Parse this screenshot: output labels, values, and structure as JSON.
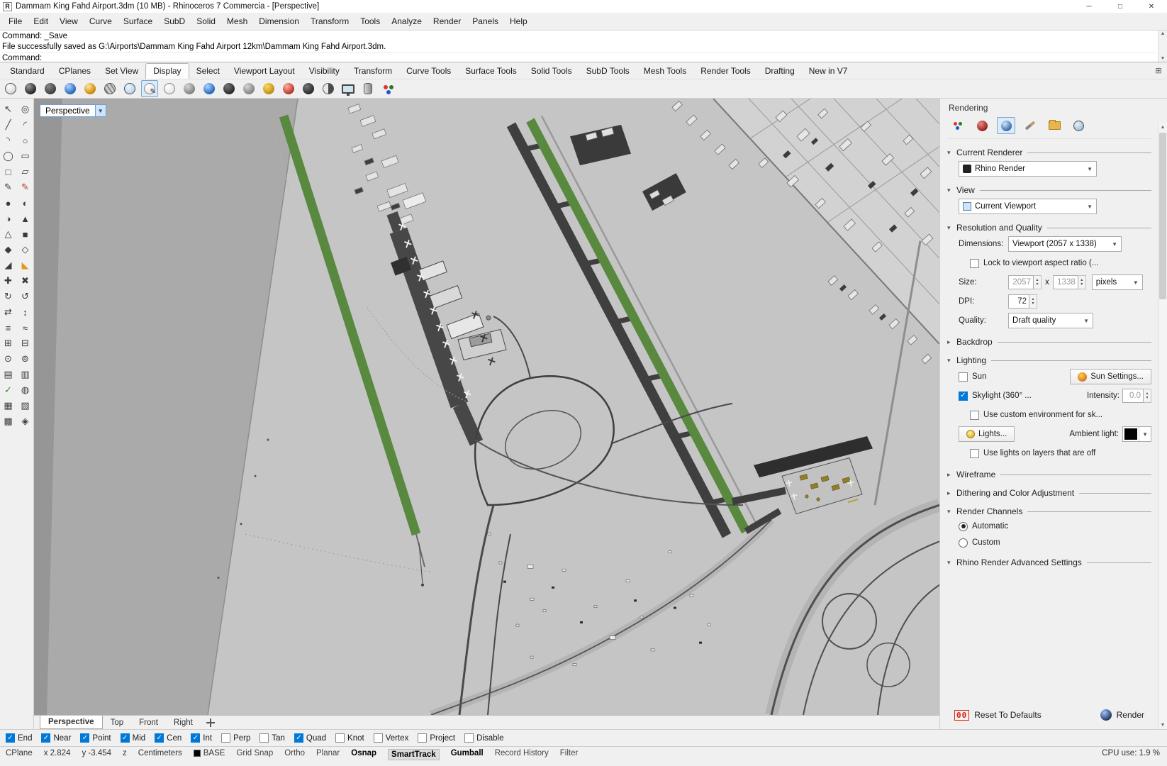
{
  "colors": {
    "runway_green": "#58893f",
    "taxiway_dark": "#3f3f3f",
    "ground_light": "#c5c5c5",
    "ground_mid": "#aaaaaa",
    "accent_blue": "#0078d7",
    "ambient_swatch": "#000000",
    "reset_icon_red": "#dd2211"
  },
  "titlebar": {
    "title": "Dammam King Fahd Airport.3dm (10 MB) - Rhinoceros 7 Commercia - [Perspective]"
  },
  "menubar": {
    "items": [
      "File",
      "Edit",
      "View",
      "Curve",
      "Surface",
      "SubD",
      "Solid",
      "Mesh",
      "Dimension",
      "Transform",
      "Tools",
      "Analyze",
      "Render",
      "Panels",
      "Help"
    ]
  },
  "command": {
    "history": [
      "Command: _Save",
      "File successfully saved as G:\\Airports\\Dammam King Fahd Airport 12km\\Dammam King Fahd Airport.3dm."
    ],
    "prompt": "Command:"
  },
  "tabbar": {
    "tabs": [
      "Standard",
      "CPlanes",
      "Set View",
      "Display",
      "Select",
      "Viewport Layout",
      "Visibility",
      "Transform",
      "Curve Tools",
      "Surface Tools",
      "Solid Tools",
      "SubD Tools",
      "Mesh Tools",
      "Render Tools",
      "Drafting",
      "New in V7"
    ],
    "active": "Display"
  },
  "display_toolbar": {
    "icons": [
      "wireframe",
      "shaded",
      "ghosted",
      "xray-blue",
      "rendered-gold",
      "technical-stripe",
      "artistic-wire",
      "pen-active",
      "arctic-white",
      "monochrome",
      "blue-pair",
      "dark-pair",
      "neutral-gray",
      "sun-gold",
      "material-red",
      "shadow-dark",
      "half-tone-duo",
      "monitor",
      "cylinder",
      "rgb-channels"
    ]
  },
  "sidebar_tools": {
    "icons": [
      "select",
      "lasso",
      "polyline",
      "control-point-curve",
      "arc",
      "circle",
      "ellipse",
      "rectangle",
      "polygon",
      "sketch",
      "point",
      "surface-from-points",
      "patch",
      "loft",
      "extrude",
      "sphere",
      "box",
      "cylinder",
      "boolean-union",
      "boolean-difference",
      "fillet",
      "chamfer",
      "move",
      "copy",
      "rotate",
      "scale",
      "mirror",
      "array",
      "trim",
      "split",
      "join",
      "explode",
      "group",
      "hide",
      "lock",
      "zoom",
      "pan",
      "undo",
      "redo",
      "check",
      "measure",
      "options"
    ]
  },
  "viewport": {
    "label": "Perspective",
    "tabs": [
      "Perspective",
      "Top",
      "Front",
      "Right"
    ],
    "active_tab": "Perspective"
  },
  "panel": {
    "title": "Rendering",
    "tab_icons": [
      "render-color-wheel",
      "materials",
      "rendering",
      "tools",
      "libraries",
      "textures"
    ],
    "current_renderer": {
      "header": "Current Renderer",
      "value": "Rhino Render"
    },
    "view": {
      "header": "View",
      "value": "Current Viewport"
    },
    "resolution": {
      "header": "Resolution and Quality",
      "dimensions_label": "Dimensions:",
      "dimensions_value": "Viewport (2057 x 1338)",
      "lock_label": "Lock to viewport aspect ratio (...",
      "lock_checked": false,
      "size_label": "Size:",
      "size_w": "2057",
      "size_x": "x",
      "size_h": "1338",
      "size_units": "pixels",
      "dpi_label": "DPI:",
      "dpi_value": "72",
      "quality_label": "Quality:",
      "quality_value": "Draft quality"
    },
    "backdrop": {
      "header": "Backdrop"
    },
    "lighting": {
      "header": "Lighting",
      "sun_label": "Sun",
      "sun_checked": false,
      "sun_settings": "Sun Settings...",
      "skylight_label": "Skylight (360° ...",
      "skylight_checked": true,
      "intensity_label": "Intensity:",
      "intensity_value": "0.0",
      "custom_env_label": "Use custom environment for sk...",
      "custom_env_checked": false,
      "lights_button": "Lights...",
      "ambient_label": "Ambient light:",
      "layers_off_label": "Use lights on layers that are off",
      "layers_off_checked": false
    },
    "wireframe": {
      "header": "Wireframe"
    },
    "dithering": {
      "header": "Dithering and Color Adjustment"
    },
    "render_channels": {
      "header": "Render Channels",
      "automatic": "Automatic",
      "automatic_selected": true,
      "custom": "Custom",
      "custom_selected": false
    },
    "advanced": {
      "header": "Rhino Render Advanced Settings"
    },
    "footer": {
      "reset": "Reset To Defaults",
      "render": "Render"
    }
  },
  "osnap": {
    "items": [
      {
        "label": "End",
        "checked": true
      },
      {
        "label": "Near",
        "checked": true
      },
      {
        "label": "Point",
        "checked": true
      },
      {
        "label": "Mid",
        "checked": true
      },
      {
        "label": "Cen",
        "checked": true
      },
      {
        "label": "Int",
        "checked": true
      },
      {
        "label": "Perp",
        "checked": false
      },
      {
        "label": "Tan",
        "checked": false
      },
      {
        "label": "Quad",
        "checked": true
      },
      {
        "label": "Knot",
        "checked": false
      },
      {
        "label": "Vertex",
        "checked": false
      },
      {
        "label": "Project",
        "checked": false
      },
      {
        "label": "Disable",
        "checked": false
      }
    ]
  },
  "statusbar": {
    "cells": [
      "CPlane",
      "x 2.824",
      "y -3.454",
      "z",
      "Centimeters"
    ],
    "layer": "BASE",
    "toggles": [
      {
        "label": "Grid Snap",
        "active": false
      },
      {
        "label": "Ortho",
        "active": false
      },
      {
        "label": "Planar",
        "active": false
      },
      {
        "label": "Osnap",
        "active": true
      },
      {
        "label": "SmartTrack",
        "active": true
      },
      {
        "label": "Gumball",
        "active": true
      },
      {
        "label": "Record History",
        "active": false
      },
      {
        "label": "Filter",
        "active": false
      }
    ],
    "cpu": "CPU use: 1.9 %"
  }
}
